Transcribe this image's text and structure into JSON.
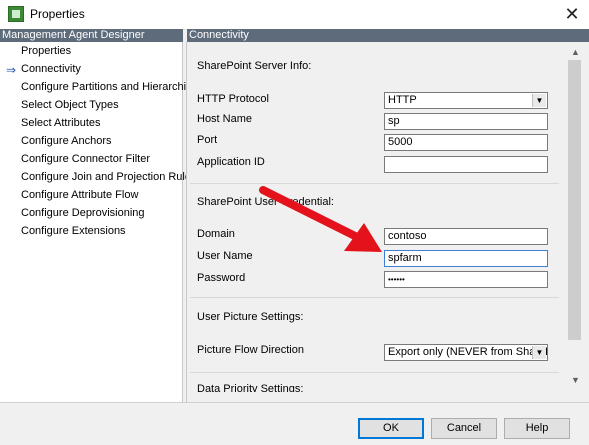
{
  "window": {
    "title": "Properties",
    "close_glyph": "✕"
  },
  "left": {
    "header": "Management Agent Designer",
    "items": [
      {
        "label": "Properties"
      },
      {
        "label": "Connectivity"
      },
      {
        "label": "Configure Partitions and Hierarchies"
      },
      {
        "label": "Select Object Types"
      },
      {
        "label": "Select Attributes"
      },
      {
        "label": "Configure Anchors"
      },
      {
        "label": "Configure Connector Filter"
      },
      {
        "label": "Configure Join and Projection Rules"
      },
      {
        "label": "Configure Attribute Flow"
      },
      {
        "label": "Configure Deprovisioning"
      },
      {
        "label": "Configure Extensions"
      }
    ],
    "selected_glyph": "⇒"
  },
  "right": {
    "header": "Connectivity",
    "server_info": {
      "title": "SharePoint Server Info:",
      "http_protocol_label": "HTTP Protocol",
      "http_protocol_value": "HTTP",
      "host_name_label": "Host Name",
      "host_name_value": "sp",
      "port_label": "Port",
      "port_value": "5000",
      "app_id_label": "Application ID",
      "app_id_value": ""
    },
    "credential": {
      "title": "SharePoint User Credential:",
      "domain_label": "Domain",
      "domain_value": "contoso",
      "user_label": "User Name",
      "user_value": "spfarm",
      "password_label": "Password",
      "password_value": "••••••"
    },
    "picture": {
      "title": "User Picture Settings:",
      "flow_label": "Picture Flow Direction",
      "flow_value": "Export only (NEVER from SharePoint)"
    },
    "data_priority": {
      "title": "Data Priority Settings:"
    }
  },
  "footer": {
    "ok": "OK",
    "cancel": "Cancel",
    "help": "Help"
  },
  "colors": {
    "header_bg": "#5d6b7b",
    "arrow": "#e3121b"
  }
}
